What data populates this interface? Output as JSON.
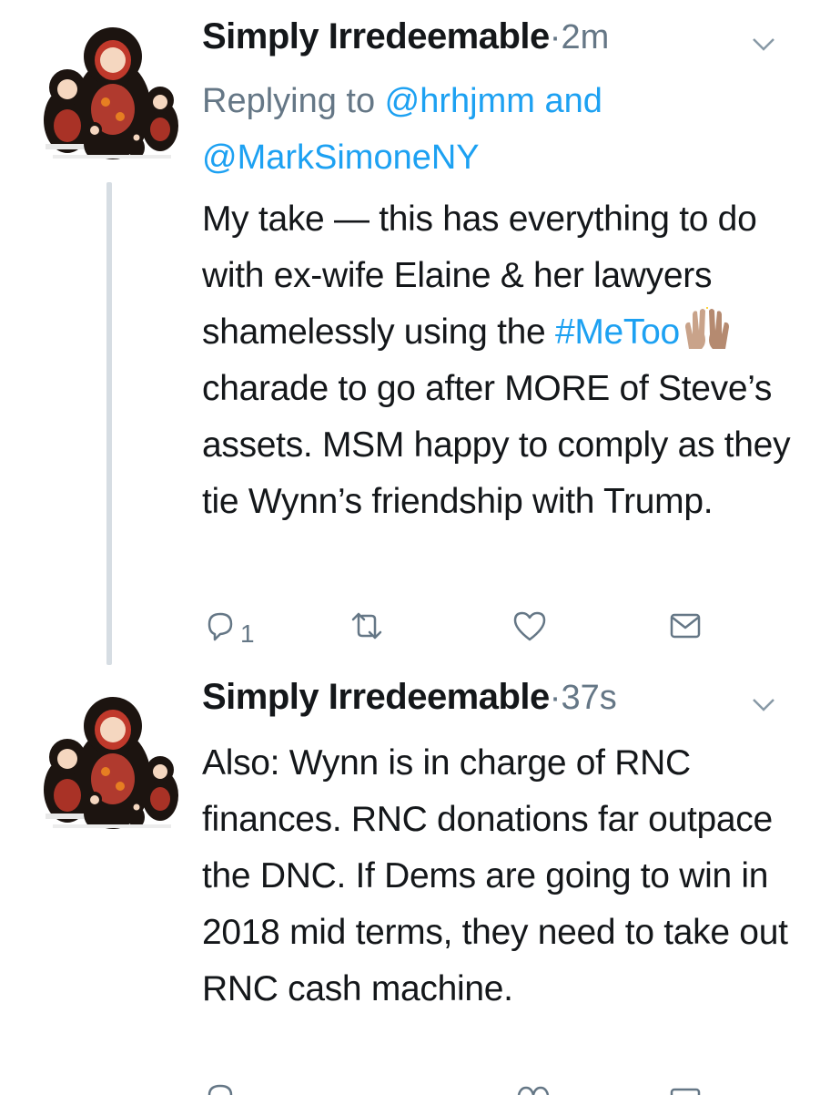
{
  "tweets": [
    {
      "author_name": "Simply Irredeemable",
      "separator": "·",
      "time": "2m",
      "replying_prefix": "Replying to ",
      "replying_handle_1": "@hrhjmm",
      "replying_and": " and",
      "replying_handle_2": "@MarkSimoneNY",
      "text_before_hashtag": "My take — this has everything to do with ex-wife Elaine & her lawyers shamelessly using the ",
      "hashtag": "#MeToo",
      "text_after_hashtag": " charade to go after MORE of Steve’s assets. MSM happy to comply as they tie Wynn’s friendship with Trump.",
      "reply_count": "1",
      "icons": [
        "reply-icon",
        "retweet-icon",
        "like-icon",
        "direct-message-icon"
      ]
    },
    {
      "author_name": "Simply Irredeemable",
      "separator": "·",
      "time": "37s",
      "text": "Also: Wynn is in charge of RNC finances. RNC donations far outpace the DNC. If Dems are going to win in 2018 mid terms, they need to take out RNC cash machine."
    }
  ],
  "colors": {
    "link": "#1da1f2",
    "muted": "#657786",
    "thread_line": "#d6dde3",
    "text": "#14171a"
  }
}
